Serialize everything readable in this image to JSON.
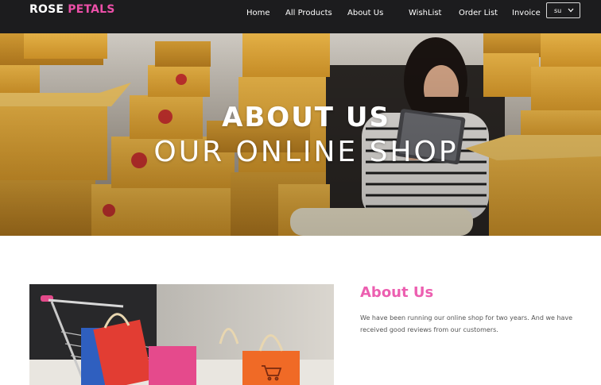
{
  "brand": {
    "part1": "ROSE",
    "part2": "PETALS"
  },
  "nav": {
    "items": [
      {
        "label": "Home"
      },
      {
        "label": "All Products"
      },
      {
        "label": "About Us"
      },
      {
        "label": "WishList"
      },
      {
        "label": "Order List"
      },
      {
        "label": "Invoice"
      }
    ],
    "language": "su"
  },
  "hero": {
    "title": "ABOUT US",
    "subtitle": "OUR ONLINE SHOP"
  },
  "about": {
    "heading": "About Us",
    "text": "We have been running our online shop for two years. And we have received good reviews from our customers."
  },
  "colors": {
    "navbar_bg": "#1c1c1e",
    "brand_accent": "#ec4fa8",
    "heading_accent": "#ec5fb0"
  },
  "icons": {
    "language_dropdown": "chevron-down-icon"
  }
}
